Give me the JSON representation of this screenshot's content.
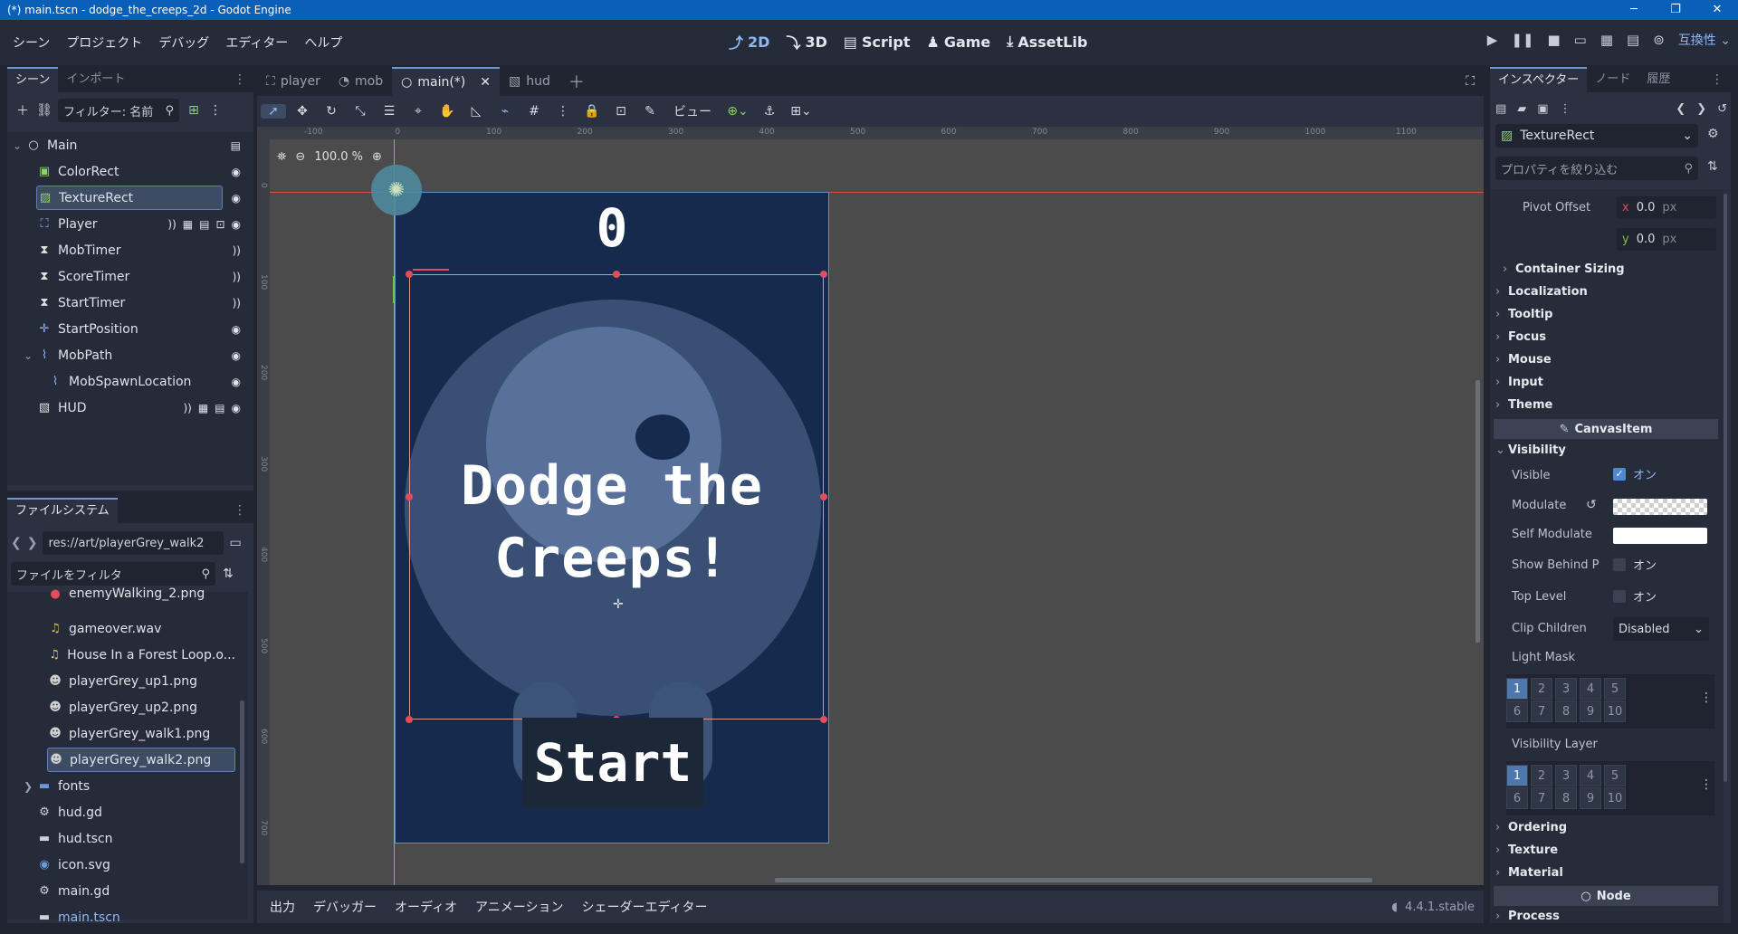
{
  "window": {
    "title": "(*) main.tscn - dodge_the_creeps_2d - Godot Engine",
    "controls": [
      "─",
      "❐",
      "✕"
    ]
  },
  "menu": [
    "シーン",
    "プロジェクト",
    "デバッグ",
    "エディター",
    "ヘルプ"
  ],
  "workspaces": [
    {
      "label": "2D",
      "icon": "2d-icon"
    },
    {
      "label": "3D",
      "icon": "3d-icon"
    },
    {
      "label": "Script",
      "icon": "script-icon"
    },
    {
      "label": "Game",
      "icon": "game-icon"
    },
    {
      "label": "AssetLib",
      "icon": "assetlib-icon"
    }
  ],
  "compat_label": "互換性",
  "scene_dock": {
    "tabs": [
      "シーン",
      "インポート"
    ],
    "filter_placeholder": "フィルター: 名前",
    "items": [
      {
        "label": "Main",
        "icon": "○",
        "icon_color": "#e0e0e0"
      },
      {
        "label": "ColorRect",
        "icon": "▣",
        "icon_color": "#8ed16b"
      },
      {
        "label": "TextureRect",
        "icon": "▨",
        "icon_color": "#8ed16b"
      },
      {
        "label": "Player",
        "icon": "⛶",
        "icon_color": "#8fb4ef"
      },
      {
        "label": "MobTimer",
        "icon": "⧗",
        "icon_color": "#e0e0e0"
      },
      {
        "label": "ScoreTimer",
        "icon": "⧗",
        "icon_color": "#e0e0e0"
      },
      {
        "label": "StartTimer",
        "icon": "⧗",
        "icon_color": "#e0e0e0"
      },
      {
        "label": "StartPosition",
        "icon": "✛",
        "icon_color": "#8fb4ef"
      },
      {
        "label": "MobPath",
        "icon": "⌇",
        "icon_color": "#8fb4ef"
      },
      {
        "label": "MobSpawnLocation",
        "icon": "⌇",
        "icon_color": "#8fb4ef"
      },
      {
        "label": "HUD",
        "icon": "▧",
        "icon_color": "#e0e0e0"
      }
    ]
  },
  "fs_dock": {
    "tab": "ファイルシステム",
    "path": "res://art/playerGrey_walk2",
    "filter_placeholder": "ファイルをフィルタ",
    "items": [
      "enemyWalking_2.png",
      "gameover.wav",
      "House In a Forest Loop.o...",
      "playerGrey_up1.png",
      "playerGrey_up2.png",
      "playerGrey_walk1.png",
      "playerGrey_walk2.png",
      "fonts",
      "hud.gd",
      "hud.tscn",
      "icon.svg",
      "main.gd",
      "main.tscn"
    ]
  },
  "editor_tabs": [
    "player",
    "mob",
    "main(*)",
    "hud"
  ],
  "toolbar": {
    "view_label": "ビュー"
  },
  "viewport": {
    "zoom": "100.0 %",
    "score": "0",
    "message": "Dodge the\nCreeps!",
    "start_label": "Start",
    "ruler_labels": [
      "-100",
      "0",
      "100",
      "200",
      "300",
      "400",
      "500",
      "600",
      "700",
      "800",
      "900",
      "1000",
      "1100"
    ],
    "vruler_labels": [
      "0",
      "100",
      "200",
      "300",
      "400",
      "500",
      "600",
      "700"
    ]
  },
  "bottom_tabs": [
    "出力",
    "デバッガー",
    "オーディオ",
    "アニメーション",
    "シェーダーエディター"
  ],
  "version": "4.4.1.stable",
  "inspector": {
    "tabs": [
      "インスペクター",
      "ノード",
      "履歴"
    ],
    "node": "TextureRect",
    "filter_placeholder": "プロパティを絞り込む",
    "pivot_offset": {
      "label": "Pivot Offset",
      "x": "0.0",
      "y": "0.0",
      "unit": "px"
    },
    "sections_top": [
      "Container Sizing",
      "Localization",
      "Tooltip",
      "Focus",
      "Mouse",
      "Input",
      "Theme"
    ],
    "category_canvas": "CanvasItem",
    "visibility": "Visibility",
    "visible": {
      "label": "Visible",
      "value": "オン"
    },
    "modulate": "Modulate",
    "self_modulate": "Self Modulate",
    "show_behind": {
      "label": "Show Behind P",
      "value": "オン"
    },
    "top_level": {
      "label": "Top Level",
      "value": "オン"
    },
    "clip_children": {
      "label": "Clip Children",
      "value": "Disabled"
    },
    "light_mask": {
      "label": "Light Mask",
      "cells": [
        "1",
        "2",
        "3",
        "4",
        "5",
        "6",
        "7",
        "8",
        "9",
        "10"
      ]
    },
    "visibility_layer": {
      "label": "Visibility Layer",
      "cells": [
        "1",
        "2",
        "3",
        "4",
        "5",
        "6",
        "7",
        "8",
        "9",
        "10"
      ]
    },
    "sections_bottom": [
      "Ordering",
      "Texture",
      "Material"
    ],
    "category_node": "Node",
    "process": "Process"
  }
}
